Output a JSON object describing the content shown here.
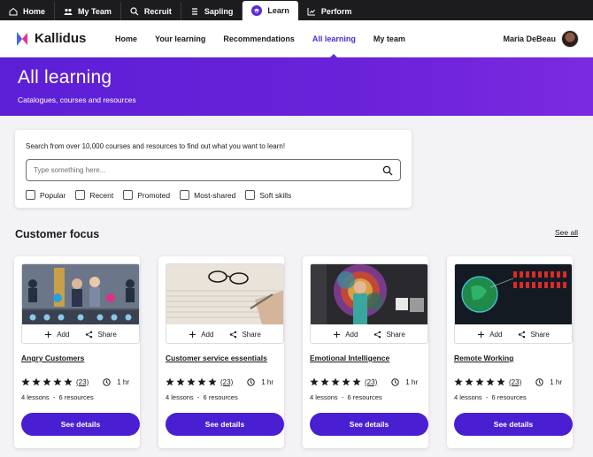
{
  "app_tabs": [
    {
      "label": "Home",
      "icon": "home-icon"
    },
    {
      "label": "My Team",
      "icon": "team-icon"
    },
    {
      "label": "Recruit",
      "icon": "recruit-icon"
    },
    {
      "label": "Sapling",
      "icon": "sapling-icon"
    },
    {
      "label": "Learn",
      "icon": "learn-icon",
      "active": true
    },
    {
      "label": "Perform",
      "icon": "chart-icon"
    }
  ],
  "brand": {
    "name": "Kallidus",
    "accent": "#5a2bd5",
    "button": "#4a1fd1"
  },
  "nav": {
    "items": [
      "Home",
      "Your learning",
      "Recommendations",
      "All learning",
      "My team"
    ],
    "active": "All learning"
  },
  "user": {
    "name": "Maria DeBeau"
  },
  "hero": {
    "title": "All learning",
    "subtitle": "Catalogues, courses and resources"
  },
  "search": {
    "prompt": "Search from over 10,000 courses and resources to find out what you want to learn!",
    "placeholder": "Type something here...",
    "value": "",
    "filters": [
      "Popular",
      "Recent",
      "Promoted",
      "Most-shared",
      "Soft skills"
    ]
  },
  "section": {
    "title": "Customer focus",
    "see_all": "See all"
  },
  "card_labels": {
    "add": "Add",
    "share": "Share",
    "button": "See details"
  },
  "courses": [
    {
      "title": "Angry Customers",
      "rating": 5,
      "reviews": "(23)",
      "duration": "1 hr",
      "meta": "4 lessons  -  6 resources"
    },
    {
      "title": "Customer service essentials",
      "rating": 5,
      "reviews": "(23)",
      "duration": "1 hr",
      "meta": "4 lessons  -  6 resources"
    },
    {
      "title": "Emotional Intelligence",
      "rating": 5,
      "reviews": "(23)",
      "duration": "1 hr",
      "meta": "4 lessons  -  6 resources"
    },
    {
      "title": "Remote Working",
      "rating": 5,
      "reviews": "(23)",
      "duration": "1 hr",
      "meta": "4 lessons  -  6 resources"
    }
  ]
}
